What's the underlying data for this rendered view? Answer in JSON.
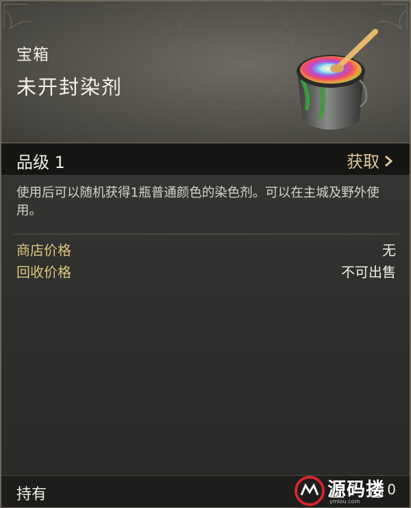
{
  "item": {
    "category": "宝箱",
    "name": "未开封染剂",
    "icon": "paint-bucket-icon"
  },
  "grade": {
    "label": "品级 1",
    "acquire_label": "获取"
  },
  "description": "使用后可以随机获得1瓶普通颜色的染色剂。可以在主城及野外使用。",
  "prices": [
    {
      "label": "商店价格",
      "value": "无"
    },
    {
      "label": "回收价格",
      "value": "不可出售"
    }
  ],
  "footer": {
    "owned_label": "持有",
    "counts": [
      {
        "icon": "warehouse-icon",
        "value": "0"
      },
      {
        "icon": "bag-icon",
        "value": "0"
      }
    ]
  },
  "watermark": {
    "text": "源码搂",
    "sub": "ymlou.com"
  },
  "colors": {
    "accent_gold": "#e0c67d",
    "acquire": "#dfc99a",
    "panel_bg": "#2b2b29"
  }
}
